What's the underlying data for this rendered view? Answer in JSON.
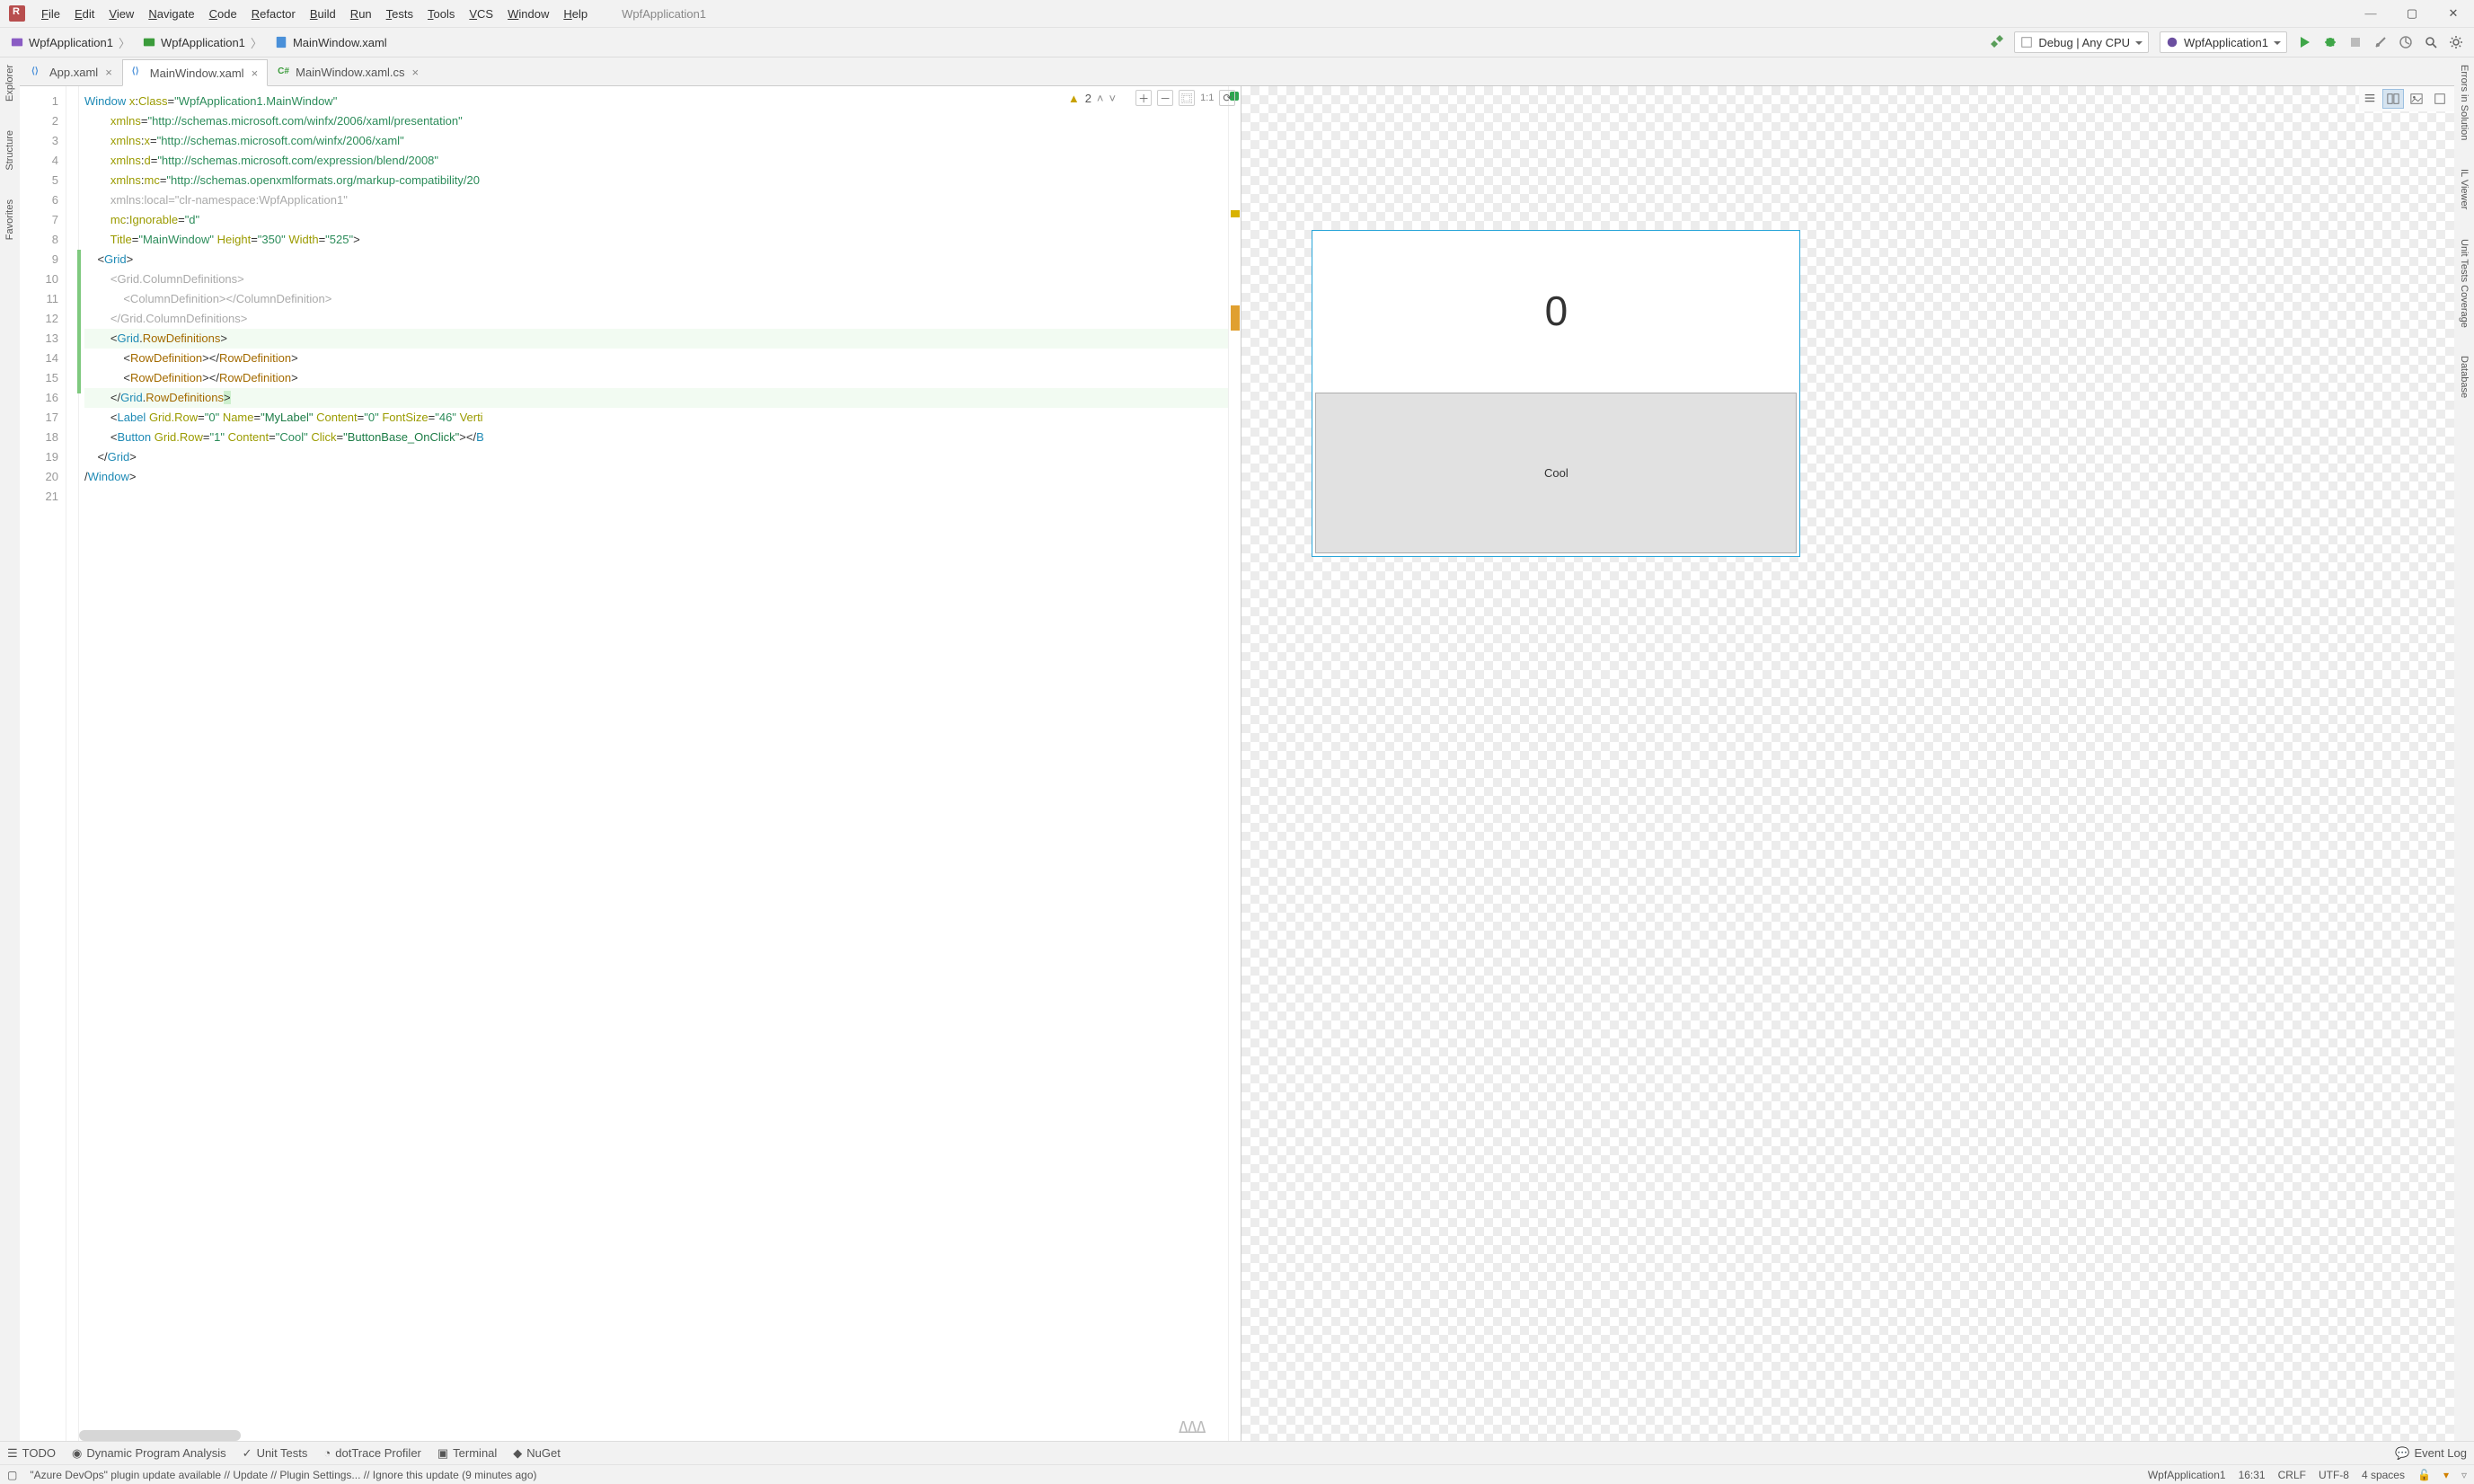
{
  "menu": {
    "items": [
      "File",
      "Edit",
      "View",
      "Navigate",
      "Code",
      "Refactor",
      "Build",
      "Run",
      "Tests",
      "Tools",
      "VCS",
      "Window",
      "Help"
    ],
    "app": "WpfApplication1"
  },
  "win_controls": {
    "min": "—",
    "max": "▢",
    "close": "✕"
  },
  "breadcrumb": {
    "a": "WpfApplication1",
    "b": "WpfApplication1",
    "c": "MainWindow.xaml",
    "sep": "〉"
  },
  "toolbar": {
    "config_label": "Debug | Any CPU",
    "project_label": "WpfApplication1"
  },
  "tabs": [
    {
      "label": "App.xaml",
      "icon": "xaml"
    },
    {
      "label": "MainWindow.xaml",
      "icon": "xaml",
      "active": true
    },
    {
      "label": "MainWindow.xaml.cs",
      "icon": "cs"
    }
  ],
  "editor": {
    "warn_count": "2",
    "one_to_one": "1:1",
    "lines": [
      {
        "n": 1,
        "html": "<span class='t-kw'>Window</span> <span class='t-attr'>x</span><span>:</span><span class='t-attr'>Class</span>=<span class='t-str'>\"WpfApplication1.MainWindow\"</span>"
      },
      {
        "n": 2,
        "html": "        <span class='t-attr'>xmlns</span>=<span class='t-str'>\"http://schemas.microsoft.com/winfx/2006/xaml/presentation\"</span>"
      },
      {
        "n": 3,
        "html": "        <span class='t-attr'>xmlns</span><span>:</span><span class='t-attr'>x</span>=<span class='t-str'>\"http://schemas.microsoft.com/winfx/2006/xaml\"</span>"
      },
      {
        "n": 4,
        "html": "        <span class='t-attr'>xmlns</span><span>:</span><span class='t-attr'>d</span>=<span class='t-str'>\"http://schemas.microsoft.com/expression/blend/2008\"</span>"
      },
      {
        "n": 5,
        "html": "        <span class='t-attr'>xmlns</span><span>:</span><span class='t-attr'>mc</span>=<span class='t-str'>\"http://schemas.openxmlformats.org/markup-compatibility/20</span>"
      },
      {
        "n": 6,
        "html": "        <span class='t-gray'>xmlns:local=\"clr-namespace:WpfApplication1\"</span>"
      },
      {
        "n": 7,
        "html": "        <span class='t-attr'>mc</span><span>:</span><span class='t-attr'>Ignorable</span>=<span class='t-str'>\"d\"</span>"
      },
      {
        "n": 8,
        "html": "        <span class='t-attr'>Title</span>=<span class='t-str'>\"MainWindow\"</span> <span class='t-attr'>Height</span>=<span class='t-str'>\"350\"</span> <span class='t-attr'>Width</span>=<span class='t-str'>\"525\"</span>&gt;"
      },
      {
        "n": 9,
        "html": "    &lt;<span class='t-kw'>Grid</span>&gt;"
      },
      {
        "n": 10,
        "html": "        <span class='t-gray'>&lt;Grid.ColumnDefinitions&gt;</span>"
      },
      {
        "n": 11,
        "html": "            <span class='t-gray'>&lt;ColumnDefinition&gt;&lt;/ColumnDefinition&gt;</span>"
      },
      {
        "n": 12,
        "html": "        <span class='t-gray'>&lt;/Grid.ColumnDefinitions&gt;</span>"
      },
      {
        "n": 13,
        "html": "        &lt;<span class='t-kw'>Grid</span>.<span class='t-tag'>RowDefinitions</span>&gt;",
        "hl": true
      },
      {
        "n": 14,
        "html": "            &lt;<span class='t-tag'>RowDefinition</span>&gt;&lt;/<span class='t-tag'>RowDefinition</span>&gt;"
      },
      {
        "n": 15,
        "html": "            &lt;<span class='t-tag'>RowDefinition</span>&gt;&lt;/<span class='t-tag'>RowDefinition</span>&gt;"
      },
      {
        "n": 16,
        "html": "        &lt;/<span class='t-kw'>Grid</span>.<span class='t-tag'>RowDefinitions</span><span style='background:#cdefcd'>&gt;</span>",
        "hl": true
      },
      {
        "n": 17,
        "html": "        &lt;<span class='t-kw'>Label</span> <span class='t-attr'>Grid.Row</span>=<span class='t-str'>\"0\"</span> <span class='t-attr'>Name</span>=<span class='t-green2'>\"MyLabel\"</span> <span class='t-attr'>Content</span>=<span class='t-str'>\"0\"</span> <span class='t-attr'>FontSize</span>=<span class='t-str'>\"46\"</span> <span class='t-attr'>Verti</span>"
      },
      {
        "n": 18,
        "html": "        &lt;<span class='t-kw'>Button</span> <span class='t-attr'>Grid.Row</span>=<span class='t-str'>\"1\"</span> <span class='t-attr'>Content</span>=<span class='t-str'>\"Cool\"</span> <span class='t-attr'>Click</span>=<span class='t-green2'>\"ButtonBase_OnClick\"</span>&gt;&lt;/<span class='t-kw'>B</span>"
      },
      {
        "n": 19,
        "html": "    &lt;/<span class='t-kw'>Grid</span>&gt;"
      },
      {
        "n": 20,
        "html": "/<span class='t-kw'>Window</span>&gt;"
      },
      {
        "n": 21,
        "html": " "
      }
    ],
    "aaa": "ΔΔΔ"
  },
  "preview": {
    "label_value": "0",
    "button_label": "Cool"
  },
  "left_tools": [
    "Explorer",
    "Structure",
    "Favorites"
  ],
  "right_tools": [
    "Errors in Solution",
    "IL Viewer",
    "Unit Tests Coverage",
    "Database"
  ],
  "bottom_tabs": [
    "TODO",
    "Dynamic Program Analysis",
    "Unit Tests",
    "dotTrace Profiler",
    "Terminal",
    "NuGet"
  ],
  "event_log": "Event Log",
  "status": {
    "msg": "\"Azure DevOps\" plugin update available // Update // Plugin Settings... // Ignore this update (9 minutes ago)",
    "proj": "WpfApplication1",
    "pos": "16:31",
    "eol": "CRLF",
    "enc": "UTF-8",
    "indent": "4 spaces"
  }
}
